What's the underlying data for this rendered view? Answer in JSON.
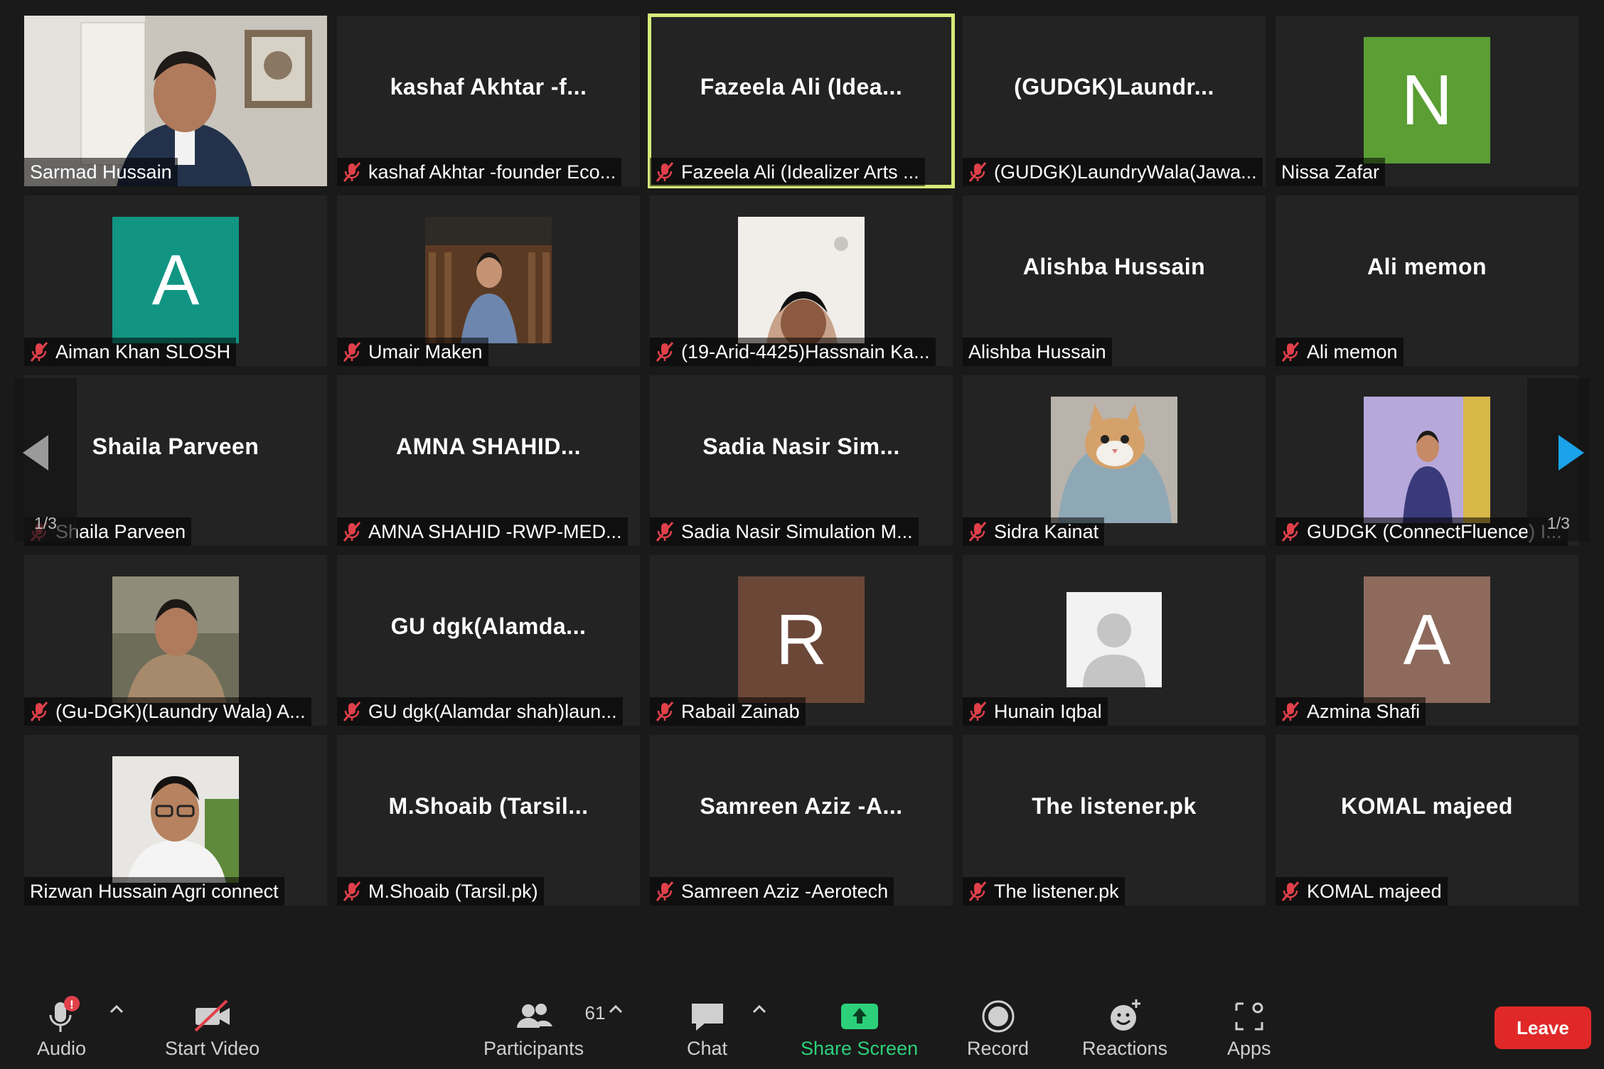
{
  "grid": {
    "tiles": [
      {
        "display": "",
        "label": "Sarmad Hussain",
        "muted": false,
        "kind": "video-sarmad"
      },
      {
        "display": "kashaf  Akhtar  -f...",
        "label": "kashaf Akhtar -founder Eco...",
        "muted": true
      },
      {
        "display": "Fazeela  Ali  (Idea...",
        "label": "Fazeela Ali (Idealizer Arts ...",
        "muted": true,
        "active": true
      },
      {
        "display": "(GUDGK)Laundr...",
        "label": "(GUDGK)LaundryWala(Jawa...",
        "muted": true
      },
      {
        "display": "",
        "label": "Nissa Zafar",
        "muted": false,
        "avatar_letter": "N",
        "avatar_color": "#5a9e34"
      },
      {
        "display": "",
        "label": "Aiman Khan SLOSH",
        "muted": true,
        "avatar_letter": "A",
        "avatar_color": "#119582"
      },
      {
        "display": "",
        "label": "Umair Maken",
        "muted": true,
        "kind": "photo-umair"
      },
      {
        "display": "",
        "label": "(19-Arid-4425)Hassnain Ka...",
        "muted": true,
        "kind": "photo-hassnain"
      },
      {
        "display": "Alishba Hussain",
        "label": "Alishba Hussain",
        "muted": false
      },
      {
        "display": "Ali memon",
        "label": "Ali memon",
        "muted": true
      },
      {
        "display": "Shaila Parveen",
        "label": "Shaila Parveen",
        "muted": true
      },
      {
        "display": "AMNA  SHAHID...",
        "label": "AMNA SHAHID -RWP-MED...",
        "muted": true
      },
      {
        "display": "Sadia Nasir   Sim...",
        "label": "Sadia Nasir  Simulation M...",
        "muted": true
      },
      {
        "display": "",
        "label": "Sidra Kainat",
        "muted": true,
        "kind": "photo-cat"
      },
      {
        "display": "",
        "label": "GUDGK (ConnectFluence) I...",
        "muted": true,
        "kind": "photo-gudgk"
      },
      {
        "display": "",
        "label": "(Gu-DGK)(Laundry Wala) A...",
        "muted": true,
        "kind": "photo-gudgk2"
      },
      {
        "display": "GU  dgk(Alamda...",
        "label": "GU dgk(Alamdar shah)laun...",
        "muted": true
      },
      {
        "display": "",
        "label": "Rabail Zainab",
        "muted": true,
        "avatar_letter": "R",
        "avatar_color": "#6b4737"
      },
      {
        "display": "",
        "label": "Hunain Iqbal",
        "muted": true,
        "kind": "photo-default"
      },
      {
        "display": "",
        "label": "Azmina Shafi",
        "muted": true,
        "avatar_letter": "A",
        "avatar_color": "#8d6a5c"
      },
      {
        "display": "",
        "label": "Rizwan Hussain Agri connect",
        "muted": false,
        "kind": "photo-rizwan"
      },
      {
        "display": "M.Shoaib  (Tarsil...",
        "label": "M.Shoaib (Tarsil.pk)",
        "muted": true
      },
      {
        "display": "Samreen Aziz  -A...",
        "label": "Samreen Aziz -Aerotech",
        "muted": true
      },
      {
        "display": "The listener.pk",
        "label": "The listener.pk",
        "muted": true
      },
      {
        "display": "KOMAL majeed",
        "label": "KOMAL majeed",
        "muted": true
      }
    ]
  },
  "pagination": {
    "left_page": "1/3",
    "right_page": "1/3"
  },
  "toolbar": {
    "audio": "Audio",
    "start_video": "Start Video",
    "participants": "Participants",
    "participant_count": "61",
    "chat": "Chat",
    "share_screen": "Share Screen",
    "record": "Record",
    "reactions": "Reactions",
    "apps": "Apps",
    "leave": "Leave",
    "audio_alert": "!"
  },
  "colors": {
    "active_speaker": "#d6ec7a",
    "share_green": "#2cd07a",
    "leave_red": "#e02828",
    "muted_red": "#e0404a",
    "nav_blue": "#1aa3e8"
  }
}
